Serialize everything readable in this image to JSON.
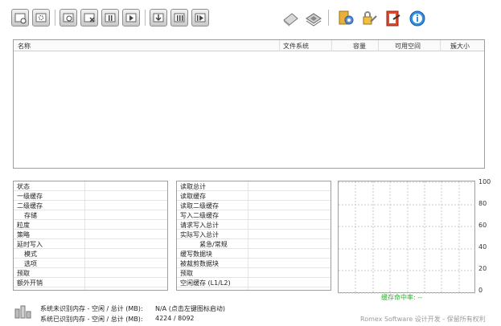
{
  "toolbar": {
    "buttons": [
      "add-cache-icon",
      "cache-settings-icon",
      "view-icon",
      "remove-icon",
      "pause-icon",
      "play-icon",
      "import-icon",
      "pause-all-icon",
      "play-all-icon"
    ],
    "app_icons": [
      "diskette-icon",
      "disk-stack-icon",
      "settings-gear-icon",
      "lock-key-icon",
      "notebook-icon",
      "about-icon"
    ]
  },
  "drive_list": {
    "columns": [
      "名称",
      "文件系统",
      "容量",
      "可用空间",
      "簇大小"
    ]
  },
  "stats_left": {
    "rows": [
      "状态",
      "一级缓存",
      "二级缓存",
      "存储",
      "粒度",
      "策略",
      "延时写入",
      "模式",
      "选项",
      "预取",
      "额外开销"
    ]
  },
  "stats_right": {
    "rows": [
      "读取总计",
      "读取缓存",
      "读取二级缓存",
      "写入二级缓存",
      "请求写入总计",
      "实际写入总计",
      "紧急/常规",
      "缓写数据块",
      "被裁剪数据块",
      "预取",
      "空闲缓存 (L1/L2)"
    ]
  },
  "chart_data": {
    "type": "line",
    "yticks": [
      "100",
      "80",
      "60",
      "40",
      "20",
      "0"
    ],
    "ylim": [
      0,
      100
    ],
    "grid": true,
    "series": [],
    "caption": "缓存命中率: --"
  },
  "footer": {
    "unrecognized_label": "系统未识别内存 - 空闲 / 总计 (MB):",
    "unrecognized_value": "N/A (点击左键图标启动)",
    "recognized_label": "系统已识别内存 - 空闲 / 总计 (MB):",
    "recognized_value": "4224 / 8092",
    "brand": "Romex Software 设计开发 - 保留所有权利"
  },
  "colors": {
    "accent_green": "#2bb02b",
    "border": "#9e9e9e"
  }
}
